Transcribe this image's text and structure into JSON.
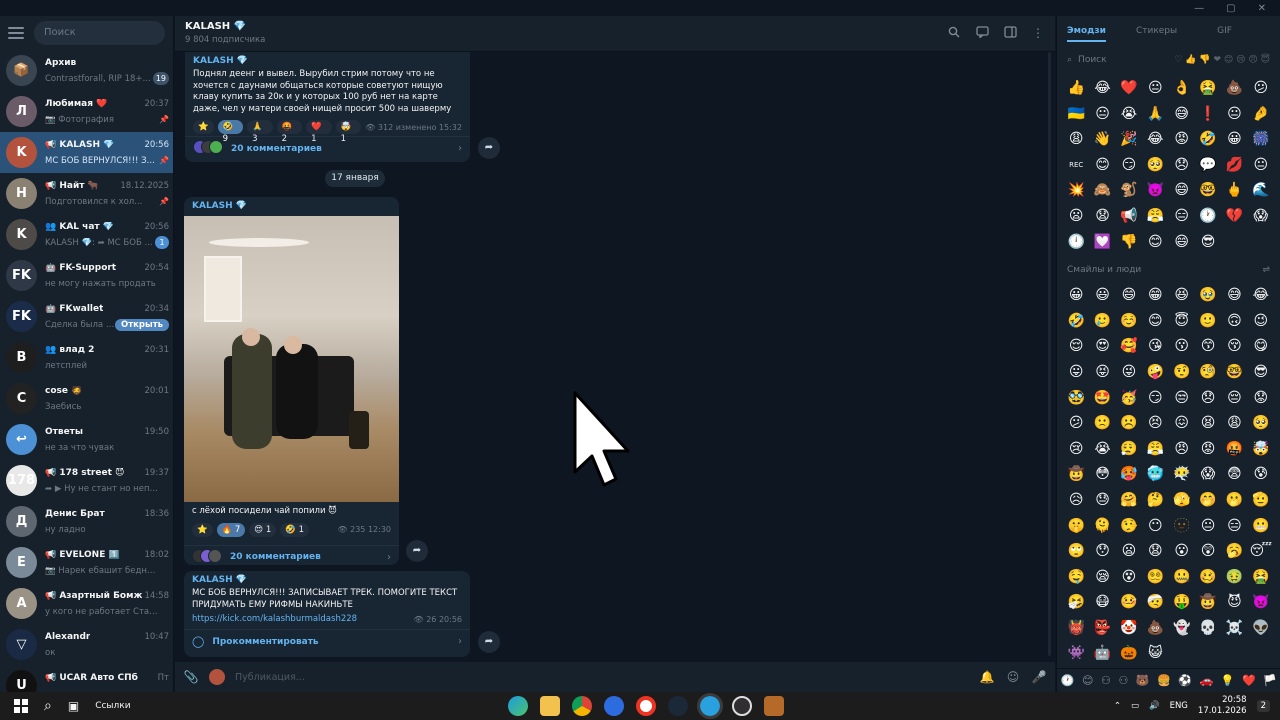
{
  "window": {
    "controls": [
      "—",
      "▢",
      "✕"
    ]
  },
  "sidebar": {
    "search_placeholder": "Поиск",
    "chats": [
      {
        "name": "Архив",
        "preview": "Contrastforall, RIP 18+…",
        "time": "",
        "badge": "19",
        "color": "#3a4552",
        "initial": "📦",
        "active": false
      },
      {
        "name": "Любимая ❤️",
        "preview": "📷 Фотография",
        "time": "20:37",
        "badge": "📌",
        "color": "#6b5b68",
        "initial": "Л",
        "active": false
      },
      {
        "name": "📢 KALASH 💎",
        "preview": "МС БОБ ВЕРНУЛСЯ!!! ЗА...",
        "time": "20:56",
        "badge": "📌",
        "color": "#b4533d",
        "initial": "K",
        "active": true
      },
      {
        "name": "📢 Найт 🐂",
        "preview": "Подготовился к хол...",
        "time": "18.12.2025",
        "badge": "📌",
        "color": "#8a8172",
        "initial": "Н",
        "active": false
      },
      {
        "name": "👥 KAL чат 💎",
        "preview": "KALASH 💎: ➦ МС БОБ ...",
        "time": "20:56",
        "badge": "1",
        "color": "#4e4a48",
        "initial": "K",
        "active": false
      },
      {
        "name": "🤖 FK-Support",
        "preview": "не могу нажать продать",
        "time": "20:54",
        "badge": "",
        "color": "#2e3846",
        "initial": "FK",
        "active": false
      },
      {
        "name": "🤖 FKwallet",
        "preview": "Сделка была от...",
        "time": "20:34",
        "badge": "Открыть",
        "color": "#1b2c4a",
        "initial": "FK",
        "active": false
      },
      {
        "name": "👥 влад 2",
        "preview": "летсплей",
        "time": "20:31",
        "badge": "",
        "color": "#1e1e1e",
        "initial": "В",
        "active": false
      },
      {
        "name": "cose 🧔",
        "preview": "Заебись",
        "time": "20:01",
        "badge": "",
        "color": "#222222",
        "initial": "C",
        "active": false
      },
      {
        "name": "Ответы",
        "preview": "не за что чувак",
        "time": "19:50",
        "badge": "",
        "color": "#4c90d6",
        "initial": "↩",
        "active": false
      },
      {
        "name": "📢 178 street 😈",
        "preview": "➦ ▶ Ну не стант но непло...",
        "time": "19:37",
        "badge": "",
        "color": "#e8e8e8",
        "initial": "178",
        "active": false
      },
      {
        "name": "Денис Брат",
        "preview": "ну ладно",
        "time": "18:36",
        "badge": "",
        "color": "#5e6670",
        "initial": "Д",
        "active": false
      },
      {
        "name": "📢 EVELONE 1️⃣",
        "preview": "📷 Нарек ебашит бедных п...",
        "time": "18:02",
        "badge": "",
        "color": "#7b8a99",
        "initial": "E",
        "active": false
      },
      {
        "name": "📢 Азартный Бомж",
        "preview": "у кого не работает  Стать р...",
        "time": "14:58",
        "badge": "",
        "color": "#9b9286",
        "initial": "А",
        "active": false
      },
      {
        "name": "Alexandr",
        "preview": "ок",
        "time": "10:47",
        "badge": "",
        "color": "#1b2a44",
        "initial": "▽",
        "active": false
      },
      {
        "name": "📢 UCAR Авто СПб",
        "preview": "",
        "time": "Пт",
        "badge": "",
        "color": "#111111",
        "initial": "U",
        "active": false
      }
    ]
  },
  "channel": {
    "title": "KALASH 💎",
    "subscribers": "9 804 подписчика"
  },
  "messages": {
    "m1": {
      "author": "KALASH 💎",
      "text": "Поднял деенг и вывел. Вырубил стрим потому что не хочется с даунами общаться которые советуют нищую клаву купить за 20к и у которых 100 руб нет на карте даже, чел у матери своей нищей просит 500 на шаверму",
      "reactions": [
        "⭐",
        "🤣 9",
        "🙏 3",
        "🤬 2",
        "❤️ 1",
        "🤯 1"
      ],
      "views": "👁 312",
      "edited": "изменено 15:32",
      "comments": "20 комментариев"
    },
    "date": "17 января",
    "m2": {
      "author": "KALASH 💎",
      "caption": "с лёхой посидели чай попили 😈",
      "reactions": [
        "⭐",
        "🔥 7",
        "😍 1",
        "🤣 1"
      ],
      "views": "👁 235",
      "time": "12:30",
      "comments": "20 комментариев"
    },
    "m3": {
      "author": "KALASH 💎",
      "text": "МС БОБ ВЕРНУЛСЯ!!! ЗАПИСЫВАЕТ ТРЕК. ПОМОГИТЕ ТЕКСТ ПРИДУМАТЬ ЕМУ РИФМЫ НАКИНЬТЕ",
      "link": "https://kick.com/kalashburmaldash228",
      "views": "👁 26",
      "time": "20:56",
      "comment_label": "Прокомментировать"
    }
  },
  "input": {
    "placeholder": "Публикация..."
  },
  "emoji_panel": {
    "tabs": [
      "Эмодзи",
      "Стикеры",
      "GIF"
    ],
    "search_placeholder": "Поиск",
    "recent": [
      "👍",
      "😂",
      "❤️",
      "😐",
      "👌",
      "🤮",
      "💩",
      "😕",
      "🇺🇦",
      "😐",
      "😭",
      "🙏",
      "😅",
      "❗",
      "😐",
      "🤌",
      "😩",
      "👋",
      "🎉",
      "😂",
      "😡",
      "🤣",
      "😀",
      "🎆",
      "REC",
      "😊",
      "😏",
      "🥺",
      "😞",
      "💬",
      "💋",
      "😐",
      "💥",
      "🙈",
      "🐒",
      "👿",
      "😄",
      "🤓",
      "🖕",
      "🌊",
      "😦",
      "😧",
      "📢",
      "😤",
      "😑",
      "🕐",
      "💔",
      "😱",
      "🕛",
      "💟",
      "👎",
      "😊",
      "😄",
      "😎"
    ],
    "section_title": "Смайлы и люди",
    "smileys": [
      "😀",
      "😃",
      "😄",
      "😁",
      "😆",
      "🥹",
      "😅",
      "😂",
      "🤣",
      "🥲",
      "☺️",
      "😊",
      "😇",
      "🙂",
      "🙃",
      "😉",
      "😌",
      "😍",
      "🥰",
      "😘",
      "😗",
      "😙",
      "😚",
      "😋",
      "😛",
      "😝",
      "😜",
      "🤪",
      "🤨",
      "🧐",
      "🤓",
      "😎",
      "🥸",
      "🤩",
      "🥳",
      "😏",
      "😒",
      "😞",
      "😔",
      "😟",
      "😕",
      "🙁",
      "☹️",
      "😣",
      "😖",
      "😫",
      "😩",
      "🥺",
      "😢",
      "😭",
      "😮‍💨",
      "😤",
      "😠",
      "😡",
      "🤬",
      "🤯",
      "🤠",
      "😳",
      "🥵",
      "🥶",
      "😶‍🌫️",
      "😱",
      "😨",
      "😰",
      "😥",
      "😓",
      "🤗",
      "🤔",
      "🫣",
      "🤭",
      "🫢",
      "🫡",
      "🤫",
      "🫠",
      "🤥",
      "😶",
      "🫥",
      "😐",
      "😑",
      "😬",
      "🙄",
      "😯",
      "😦",
      "😧",
      "😮",
      "😲",
      "🥱",
      "😴",
      "🤤",
      "😪",
      "😵",
      "😵‍💫",
      "🤐",
      "🥴",
      "🤢",
      "🤮",
      "🤧",
      "😷",
      "🤒",
      "🤕",
      "🤑",
      "🤠",
      "😈",
      "👿",
      "👹",
      "👺",
      "🤡",
      "💩",
      "👻",
      "💀",
      "☠️",
      "👽",
      "👾",
      "🤖",
      "🎃",
      "😺"
    ],
    "bottom": [
      "🕐",
      "😊",
      "⚇",
      "⚇",
      "🐻",
      "🍔",
      "⚽",
      "🚗",
      "💡",
      "❤️",
      "🏳️"
    ]
  },
  "taskbar": {
    "search_label": "Ссылки",
    "lang": "ENG",
    "time": "20:58",
    "date": "17.01.2026",
    "notif": "2"
  }
}
